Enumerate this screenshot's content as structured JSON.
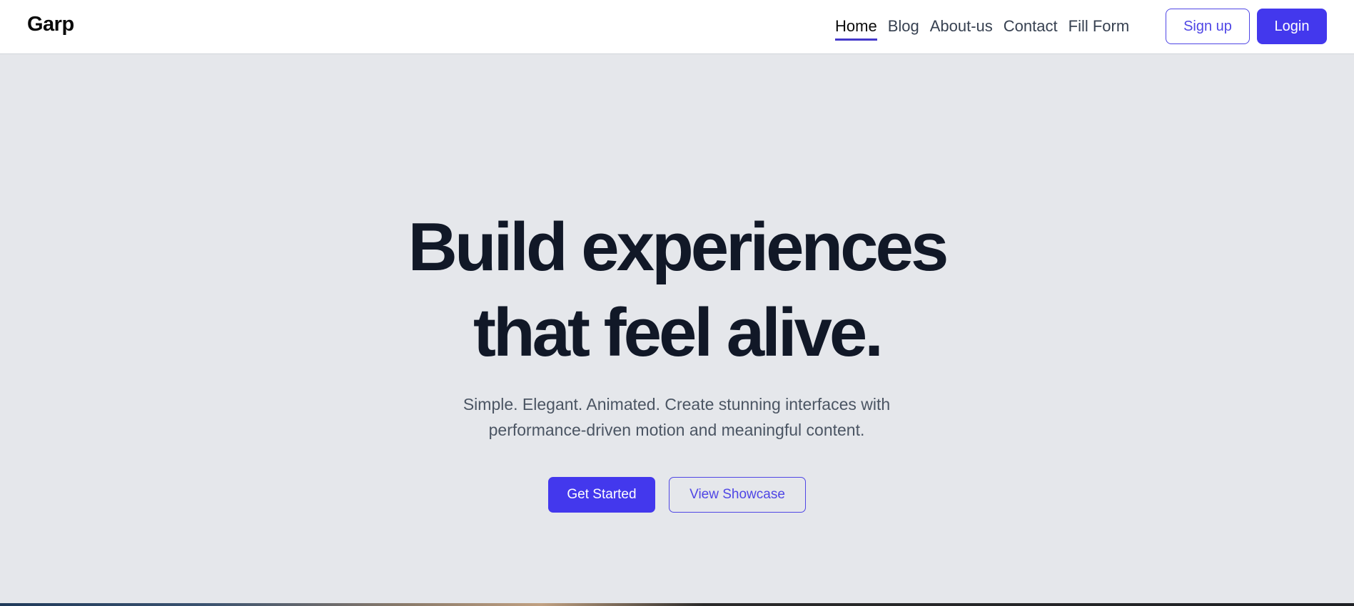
{
  "navbar": {
    "brand": "Garp",
    "links": [
      {
        "label": "Home",
        "active": true
      },
      {
        "label": "Blog",
        "active": false
      },
      {
        "label": "About-us",
        "active": false
      },
      {
        "label": "Contact",
        "active": false
      },
      {
        "label": "Fill Form",
        "active": false
      }
    ],
    "signup_label": "Sign up",
    "login_label": "Login"
  },
  "hero": {
    "title_line1": "Build experiences",
    "title_line2": "that feel alive.",
    "subtitle": "Simple. Elegant. Animated. Create stunning interfaces with performance-driven motion and meaningful content.",
    "primary_button": "Get Started",
    "secondary_button": "View Showcase"
  },
  "colors": {
    "accent": "#4338ed",
    "page_background": "#e5e7eb",
    "heading": "#111827",
    "body_text": "#4b5563"
  }
}
